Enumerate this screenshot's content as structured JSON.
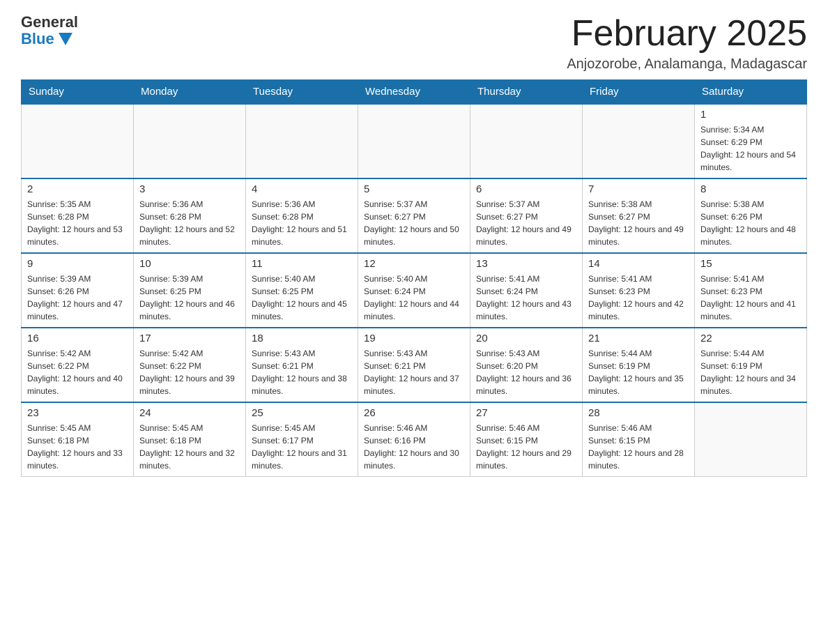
{
  "logo": {
    "general": "General",
    "blue": "Blue"
  },
  "title": "February 2025",
  "location": "Anjozorobe, Analamanga, Madagascar",
  "weekdays": [
    "Sunday",
    "Monday",
    "Tuesday",
    "Wednesday",
    "Thursday",
    "Friday",
    "Saturday"
  ],
  "weeks": [
    [
      {
        "day": "",
        "info": ""
      },
      {
        "day": "",
        "info": ""
      },
      {
        "day": "",
        "info": ""
      },
      {
        "day": "",
        "info": ""
      },
      {
        "day": "",
        "info": ""
      },
      {
        "day": "",
        "info": ""
      },
      {
        "day": "1",
        "info": "Sunrise: 5:34 AM\nSunset: 6:29 PM\nDaylight: 12 hours and 54 minutes."
      }
    ],
    [
      {
        "day": "2",
        "info": "Sunrise: 5:35 AM\nSunset: 6:28 PM\nDaylight: 12 hours and 53 minutes."
      },
      {
        "day": "3",
        "info": "Sunrise: 5:36 AM\nSunset: 6:28 PM\nDaylight: 12 hours and 52 minutes."
      },
      {
        "day": "4",
        "info": "Sunrise: 5:36 AM\nSunset: 6:28 PM\nDaylight: 12 hours and 51 minutes."
      },
      {
        "day": "5",
        "info": "Sunrise: 5:37 AM\nSunset: 6:27 PM\nDaylight: 12 hours and 50 minutes."
      },
      {
        "day": "6",
        "info": "Sunrise: 5:37 AM\nSunset: 6:27 PM\nDaylight: 12 hours and 49 minutes."
      },
      {
        "day": "7",
        "info": "Sunrise: 5:38 AM\nSunset: 6:27 PM\nDaylight: 12 hours and 49 minutes."
      },
      {
        "day": "8",
        "info": "Sunrise: 5:38 AM\nSunset: 6:26 PM\nDaylight: 12 hours and 48 minutes."
      }
    ],
    [
      {
        "day": "9",
        "info": "Sunrise: 5:39 AM\nSunset: 6:26 PM\nDaylight: 12 hours and 47 minutes."
      },
      {
        "day": "10",
        "info": "Sunrise: 5:39 AM\nSunset: 6:25 PM\nDaylight: 12 hours and 46 minutes."
      },
      {
        "day": "11",
        "info": "Sunrise: 5:40 AM\nSunset: 6:25 PM\nDaylight: 12 hours and 45 minutes."
      },
      {
        "day": "12",
        "info": "Sunrise: 5:40 AM\nSunset: 6:24 PM\nDaylight: 12 hours and 44 minutes."
      },
      {
        "day": "13",
        "info": "Sunrise: 5:41 AM\nSunset: 6:24 PM\nDaylight: 12 hours and 43 minutes."
      },
      {
        "day": "14",
        "info": "Sunrise: 5:41 AM\nSunset: 6:23 PM\nDaylight: 12 hours and 42 minutes."
      },
      {
        "day": "15",
        "info": "Sunrise: 5:41 AM\nSunset: 6:23 PM\nDaylight: 12 hours and 41 minutes."
      }
    ],
    [
      {
        "day": "16",
        "info": "Sunrise: 5:42 AM\nSunset: 6:22 PM\nDaylight: 12 hours and 40 minutes."
      },
      {
        "day": "17",
        "info": "Sunrise: 5:42 AM\nSunset: 6:22 PM\nDaylight: 12 hours and 39 minutes."
      },
      {
        "day": "18",
        "info": "Sunrise: 5:43 AM\nSunset: 6:21 PM\nDaylight: 12 hours and 38 minutes."
      },
      {
        "day": "19",
        "info": "Sunrise: 5:43 AM\nSunset: 6:21 PM\nDaylight: 12 hours and 37 minutes."
      },
      {
        "day": "20",
        "info": "Sunrise: 5:43 AM\nSunset: 6:20 PM\nDaylight: 12 hours and 36 minutes."
      },
      {
        "day": "21",
        "info": "Sunrise: 5:44 AM\nSunset: 6:19 PM\nDaylight: 12 hours and 35 minutes."
      },
      {
        "day": "22",
        "info": "Sunrise: 5:44 AM\nSunset: 6:19 PM\nDaylight: 12 hours and 34 minutes."
      }
    ],
    [
      {
        "day": "23",
        "info": "Sunrise: 5:45 AM\nSunset: 6:18 PM\nDaylight: 12 hours and 33 minutes."
      },
      {
        "day": "24",
        "info": "Sunrise: 5:45 AM\nSunset: 6:18 PM\nDaylight: 12 hours and 32 minutes."
      },
      {
        "day": "25",
        "info": "Sunrise: 5:45 AM\nSunset: 6:17 PM\nDaylight: 12 hours and 31 minutes."
      },
      {
        "day": "26",
        "info": "Sunrise: 5:46 AM\nSunset: 6:16 PM\nDaylight: 12 hours and 30 minutes."
      },
      {
        "day": "27",
        "info": "Sunrise: 5:46 AM\nSunset: 6:15 PM\nDaylight: 12 hours and 29 minutes."
      },
      {
        "day": "28",
        "info": "Sunrise: 5:46 AM\nSunset: 6:15 PM\nDaylight: 12 hours and 28 minutes."
      },
      {
        "day": "",
        "info": ""
      }
    ]
  ]
}
